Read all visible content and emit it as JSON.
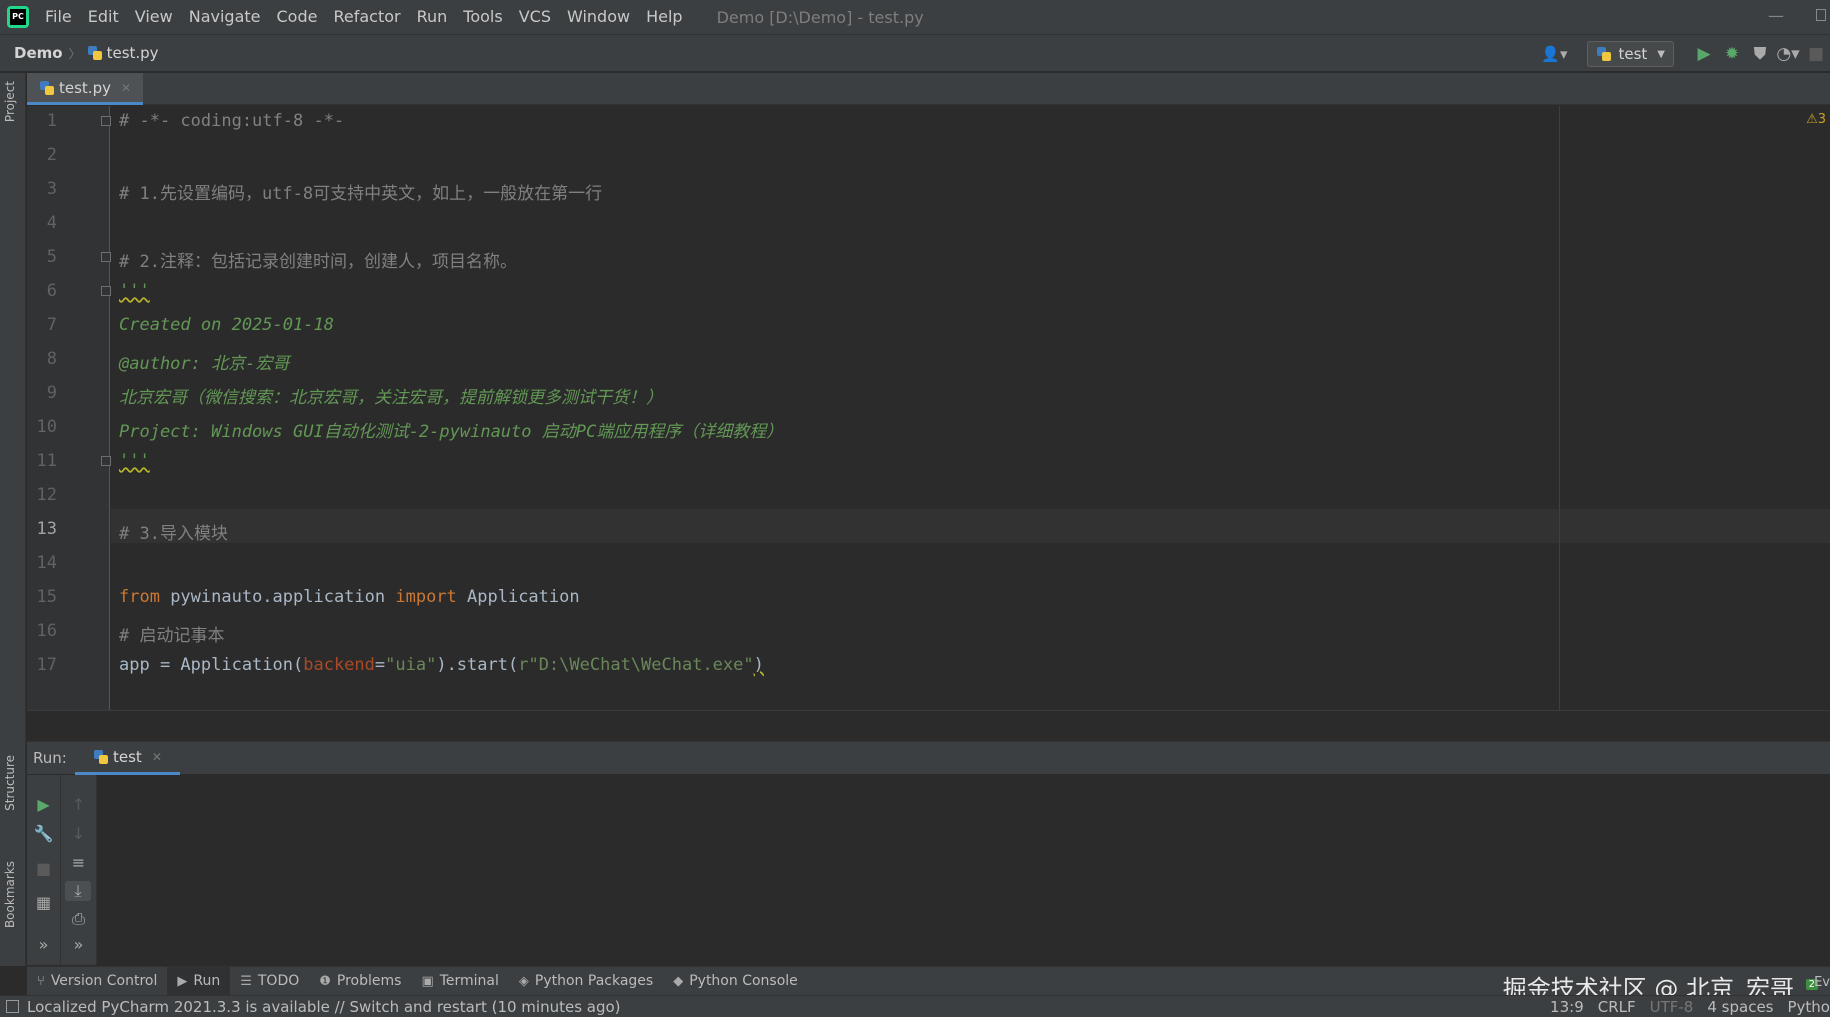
{
  "menubar": {
    "items": [
      "File",
      "Edit",
      "View",
      "Navigate",
      "Code",
      "Refactor",
      "Run",
      "Tools",
      "VCS",
      "Window",
      "Help"
    ],
    "window_title": "Demo [D:\\Demo] - test.py",
    "minimize_glyph": "—"
  },
  "navbar": {
    "project": "Demo",
    "file": "test.py",
    "run_config": "test"
  },
  "editor": {
    "tab_label": "test.py",
    "line_numbers": [
      "1",
      "2",
      "3",
      "4",
      "5",
      "6",
      "7",
      "8",
      "9",
      "10",
      "11",
      "12",
      "13",
      "14",
      "15",
      "16",
      "17"
    ],
    "current_line": "13",
    "lines": {
      "l1": "# -*- coding:utf-8 -*-",
      "l3": "# 1.先设置编码，utf-8可支持中英文，如上，一般放在第一行",
      "l5": "# 2.注释：包括记录创建时间，创建人，项目名称。",
      "l6": "'''",
      "l7": "Created on 2025-01-18",
      "l8": "@author: 北京-宏哥",
      "l9": "北京宏哥（微信搜索：北京宏哥，关注宏哥，提前解锁更多测试干货！）",
      "l10": "Project: Windows GUI自动化测试-2-pywinauto 启动PC端应用程序（详细教程）",
      "l11": "'''",
      "l13": "# 3.导入模块",
      "l15_kw1": "from",
      "l15_mod": " pywinauto.application ",
      "l15_kw2": "import",
      "l15_name": " Application",
      "l16": "# 启动记事本",
      "l17_a": "app = Application(",
      "l17_param": "backend",
      "l17_eq": "=",
      "l17_str1": "\"uia\"",
      "l17_b": ").start(",
      "l17_str2": "r\"D:\\WeChat\\WeChat.exe\"",
      "l17_c": ")"
    },
    "warning_badge": "⚠3"
  },
  "left_strip": {
    "project": "Project",
    "structure": "Structure",
    "bookmarks": "Bookmarks"
  },
  "run_panel": {
    "label": "Run:",
    "tab_label": "test"
  },
  "bottom_tabs": [
    {
      "label": "Version Control",
      "icon": "⑂"
    },
    {
      "label": "Run",
      "icon": "▶"
    },
    {
      "label": "TODO",
      "icon": "☰"
    },
    {
      "label": "Problems",
      "icon": "❶"
    },
    {
      "label": "Terminal",
      "icon": "▣"
    },
    {
      "label": "Python Packages",
      "icon": "◈"
    },
    {
      "label": "Python Console",
      "icon": "◆"
    }
  ],
  "watermark": "掘金技术社区 @ 北京_宏哥",
  "watermark_badge": "2",
  "watermark_tail": "Ev",
  "statusbar": {
    "message": "Localized PyCharm 2021.3.3 is available // Switch and restart (10 minutes ago)",
    "position": "13:9",
    "line_sep": "CRLF",
    "encoding": "UTF-8",
    "indent": "4 spaces",
    "interpreter": "Pytho"
  },
  "colors": {
    "accent": "#4a88c7",
    "keyword": "#cc7832",
    "string": "#6a8759",
    "docstring": "#629755",
    "comment": "#808080"
  }
}
